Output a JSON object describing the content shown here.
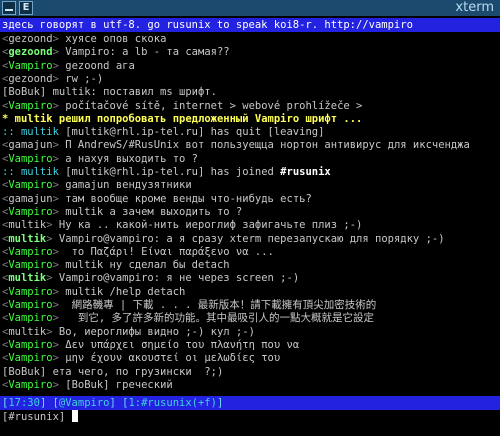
{
  "window": {
    "title": "xterm",
    "btn2_label": "E"
  },
  "topic": "здесь говорят в utf-8. go rusunix to speak koi8-r. http://vampiro",
  "lines": [
    {
      "nick": "gezoond",
      "style": "norm",
      "text": "хуясе опов скока"
    },
    {
      "nick": "gezoond",
      "style": "bright",
      "text": "Vampiro: а lb - та самая??"
    },
    {
      "nick": "Vampiro",
      "style": "green",
      "text": "gezoond ага"
    },
    {
      "nick": "gezoond",
      "style": "norm",
      "text": "rw ;-)"
    },
    {
      "nick": "[BoBuk]",
      "style": "norm",
      "text": "multik: поставил ms шрифт."
    },
    {
      "nick": "Vampiro",
      "style": "green",
      "text": "počítačové sítě, internet > webové prohlížeče >"
    },
    {
      "nick": "multik",
      "style": "action",
      "text": "решил попробовать предложенный Vampiro шрифт ..."
    },
    {
      "nick": "multik",
      "style": "quit",
      "text": "[multik@rhl.ip-tel.ru] has quit [leaving]"
    },
    {
      "nick": "gamajun",
      "style": "norm",
      "text": "П AndrewS/#RusUnix вот пользуещца нортон антивирус для иксченджа"
    },
    {
      "nick": "Vampiro",
      "style": "green",
      "text": "а нахуя выходить то ?"
    },
    {
      "nick": "multik",
      "style": "join",
      "text": "[multik@rhl.ip-tel.ru] has joined ",
      "chan": "#rusunix"
    },
    {
      "nick": "Vampiro",
      "style": "green",
      "text": "gamajun вендузятники"
    },
    {
      "nick": "gamajun",
      "style": "norm",
      "text": "там вообще кроме венды что-нибудь есть?"
    },
    {
      "nick": "Vampiro",
      "style": "green",
      "text": "multik а зачем выходить то ?"
    },
    {
      "nick": "multik",
      "style": "norm",
      "text": "Ну ка .. какой-нить иероглиф зафигачьте плиз ;-)"
    },
    {
      "nick": "multik",
      "style": "bright",
      "text": "Vampiro@vampiro: а я сразу xterm перезапускаю для порядку ;-)"
    },
    {
      "nick": "Vampiro",
      "style": "green",
      "text": " то Παζάρι! Είναι παράξενο να ..."
    },
    {
      "nick": "Vampiro",
      "style": "green",
      "text": "multik ну сделал бы detach"
    },
    {
      "nick": "multik",
      "style": "bright",
      "text": "Vampiro@vampiro: я не через screen ;-)"
    },
    {
      "nick": "Vampiro",
      "style": "green",
      "text": "multik /help detach"
    },
    {
      "nick": "Vampiro",
      "style": "green",
      "text": " 網路鞿專 | 下載 . . . 最新版本！請下載擁有頂尖加密技術的"
    },
    {
      "nick": "Vampiro",
      "style": "green",
      "text": "  到它, 多了許多新的功能。其中最吸引人的一點大概就是它設定"
    },
    {
      "nick": "multik",
      "style": "norm",
      "text": "Во, иероглифы видно ;-) кул ;-)"
    },
    {
      "nick": "Vampiro",
      "style": "green",
      "text": "Δεν υπάρχει σημείο του πλανήτη που να"
    },
    {
      "nick": "Vampiro",
      "style": "green",
      "text": "μην έχουν ακουστεί οι μελωδίες του"
    },
    {
      "nick": "[BoBuk]",
      "style": "norm",
      "text": "ета чего, по грузински  ?;)"
    },
    {
      "nick": "Vampiro",
      "style": "green",
      "text": "[BoBuk] греческий"
    }
  ],
  "status": {
    "time": "17:30",
    "nick": "@Vampiro",
    "window": "1:#rusunix(+f)"
  },
  "input": {
    "prompt": "[#rusunix]",
    "value": ""
  },
  "colors": {
    "titlebar": "#1b4a6e",
    "topic_bg": "#2222e0",
    "own_nick": "#3cff3c"
  }
}
